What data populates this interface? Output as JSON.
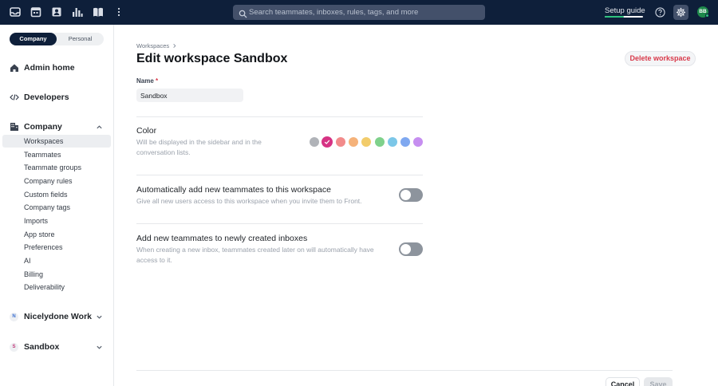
{
  "topbar": {
    "icons": [
      "inbox-icon",
      "calendar-icon",
      "contacts-icon",
      "analytics-icon",
      "knowledge-base-icon",
      "more-vertical-icon"
    ],
    "search_placeholder": "Search teammates, inboxes, rules, tags, and more",
    "setup_guide_label": "Setup guide",
    "setup_progress": 0.5,
    "avatar_initials": "BB",
    "accent_color": "#0e1f3a"
  },
  "sidebar": {
    "segment": {
      "active": "Company",
      "inactive": "Personal"
    },
    "admin_home": "Admin home",
    "developers": "Developers",
    "company": "Company",
    "company_items": [
      "Workspaces",
      "Teammates",
      "Teammate groups",
      "Company rules",
      "Custom fields",
      "Company tags",
      "Imports",
      "App store",
      "Preferences",
      "AI",
      "Billing",
      "Deliverability"
    ],
    "workspaces": [
      {
        "badge": "N",
        "label": "Nicelydone Workspace",
        "badge_color": "#3b6fd1"
      },
      {
        "badge": "S",
        "label": "Sandbox",
        "badge_color": "#c23a7a"
      }
    ]
  },
  "main": {
    "breadcrumb": "Workspaces",
    "title": "Edit workspace Sandbox",
    "delete_button": "Delete workspace",
    "name_label": "Name",
    "name_required": "*",
    "name_value": "Sandbox",
    "color_section": {
      "title": "Color",
      "description": "Will be displayed in the sidebar and in the conversation lists.",
      "swatches": [
        "#b0b3b8",
        "#d63384",
        "#f28b8b",
        "#f5b27a",
        "#f2cc6b",
        "#7fd18b",
        "#7cc7e8",
        "#7fa8f0",
        "#c68ef0"
      ],
      "selected_index": 1
    },
    "auto_add_section": {
      "title": "Automatically add new teammates to this workspace",
      "description": "Give all new users access to this workspace when you invite them to Front.",
      "enabled": false
    },
    "new_inboxes_section": {
      "title": "Add new teammates to newly created inboxes",
      "description": "When creating a new inbox, teammates created later on will automatically have access to it.",
      "enabled": false
    },
    "cancel_button": "Cancel",
    "save_button": "Save"
  }
}
